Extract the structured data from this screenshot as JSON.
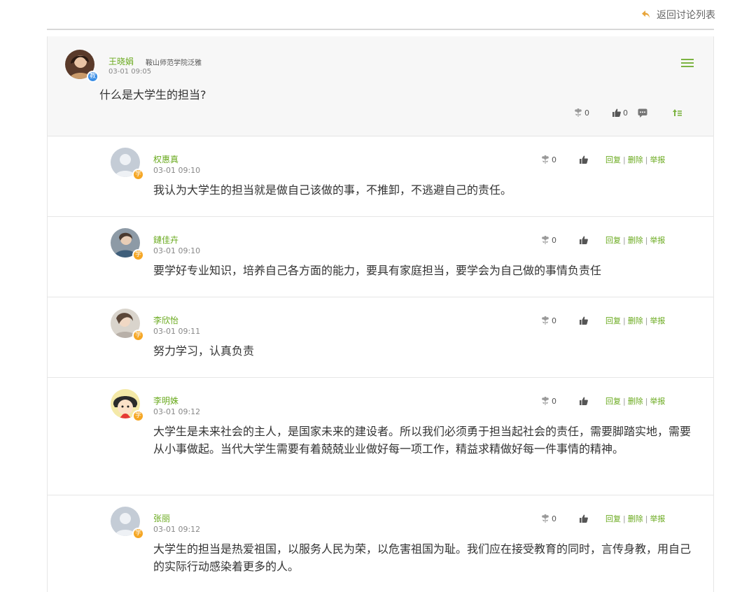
{
  "header": {
    "back_label": "返回讨论列表"
  },
  "post": {
    "author": "王晓娟",
    "school": "鞍山师范学院泛雅",
    "role_badge": "教",
    "time": "03-01 09:05",
    "question": "什么是大学生的担当?",
    "flower_count": "0",
    "like_count": "0"
  },
  "reply_links": {
    "reply": "回复",
    "delete": "删除",
    "report": "举报"
  },
  "replies": [
    {
      "name": "权惠真",
      "time": "03-01 09:10",
      "badge": "学",
      "flower_count": "0",
      "text": "我认为大学生的担当就是做自己该做的事，不推卸，不逃避自己的责任。"
    },
    {
      "name": "鏈佳卉",
      "time": "03-01 09:10",
      "badge": "学",
      "flower_count": "0",
      "text": "要学好专业知识，培养自己各方面的能力，要具有家庭担当，要学会为自己做的事情负责任"
    },
    {
      "name": "李欣怡",
      "time": "03-01 09:11",
      "badge": "学",
      "flower_count": "0",
      "text": "努力学习，认真负责"
    },
    {
      "name": "李明姝",
      "time": "03-01 09:12",
      "badge": "学",
      "flower_count": "0",
      "text": "大学生是未来社会的主人，是国家未来的建设者。所以我们必须勇于担当起社会的责任，需要脚踏实地，需要从小事做起。当代大学生需要有着兢兢业业做好每一项工作，精益求精做好每一件事情的精神。"
    },
    {
      "name": "张丽",
      "time": "03-01 09:12",
      "badge": "学",
      "flower_count": "0",
      "text": "大学生的担当是热爱祖国，以服务人民为荣，以危害祖国为耻。我们应在接受教育的同时，言传身教，用自己的实际行动感染着更多的人。"
    }
  ]
}
